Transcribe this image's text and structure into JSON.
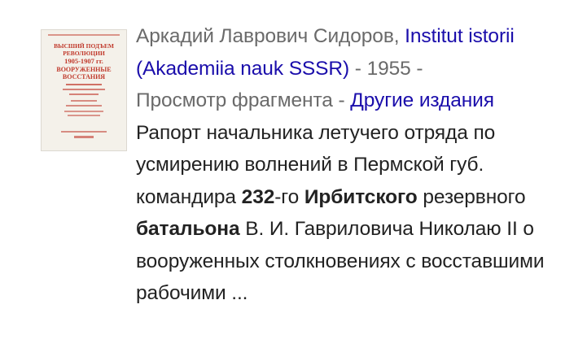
{
  "result": {
    "author": "Аркадий Лаврович Сидоров",
    "author_sep": ", ",
    "publisher_link": "Institut istorii (Akademiia nauk SSSR)",
    "year_sep": " - ",
    "year": "1955",
    "year_tail": " - ",
    "preview_text": "Просмотр фрагмента",
    "preview_sep": " - ",
    "other_editions_link": "Другие издания",
    "snippet": {
      "t1": "Рапорт начальника летучего отряда по усмирению волнений в Пермской губ. командира ",
      "b1": "232",
      "t2": "-го ",
      "b2": "Ирбитского",
      "t3": " резервного ",
      "b3": "батальона",
      "t4": " В. И. Гавриловича Николаю II о вооруженных столкновениях с восставшими рабочими ..."
    },
    "cover": {
      "icon": "book-cover-thumbnail",
      "title_lines": [
        "ВЫСШИЙ ПОДЪЕМ",
        "РЕВОЛЮЦИИ",
        "1905-1907 гг.",
        "ВООРУЖЕННЫЕ",
        "ВОССТАНИЯ"
      ]
    }
  },
  "colors": {
    "link": "#1a0dab",
    "meta": "#6a6a6a",
    "text": "#222222",
    "cover_accent": "#c0392b"
  }
}
